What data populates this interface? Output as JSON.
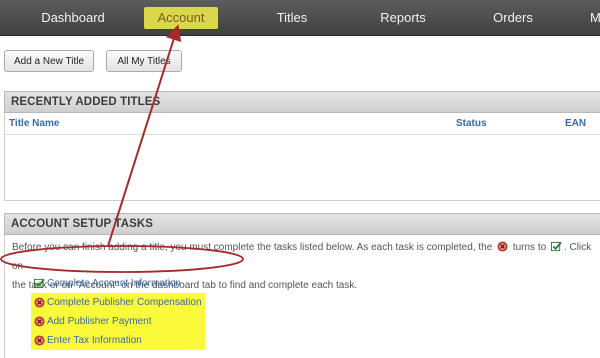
{
  "nav": {
    "items": [
      {
        "label": "Dashboard"
      },
      {
        "label": "Account"
      },
      {
        "label": "Titles"
      },
      {
        "label": "Reports"
      },
      {
        "label": "Orders"
      },
      {
        "label": "M"
      }
    ],
    "active": "Account"
  },
  "toolbar": {
    "add_title_label": "Add a New Title",
    "all_titles_label": "All My Titles"
  },
  "recent": {
    "header": "RECENTLY ADDED TITLES",
    "columns": [
      "Title Name",
      "Status",
      "EAN"
    ]
  },
  "setup": {
    "header": "ACCOUNT SETUP TASKS",
    "intro_part1": "Before you can finish adding a title, you must complete the tasks listed below. As each task is completed, the",
    "intro_turns_to": "turns to",
    "intro_part2": ". Click on",
    "intro_line2": "the task or on \"Account\" on the dashboard tab to find and complete each task.",
    "tasks": [
      {
        "label": "Complete Account Information",
        "status": "complete",
        "icon": "check-icon"
      },
      {
        "label": "Complete Publisher Compensation",
        "status": "incomplete",
        "icon": "x-circle-icon"
      },
      {
        "label": "Add Publisher Payment",
        "status": "incomplete",
        "icon": "x-circle-icon"
      },
      {
        "label": "Enter Tax Information",
        "status": "incomplete",
        "icon": "x-circle-icon"
      }
    ]
  },
  "colors": {
    "nav_bg": "#4a4a4a",
    "active_tab": "#d8d84a",
    "link_blue": "#3a6aa5",
    "highlight": "#fafa3a",
    "annotation_red": "#a52a2a"
  }
}
